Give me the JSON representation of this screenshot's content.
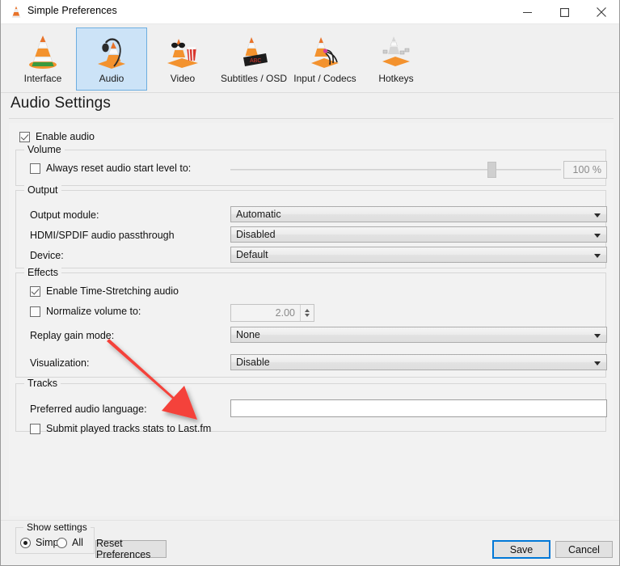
{
  "window": {
    "title": "Simple Preferences",
    "icon": "vlc-cone-icon",
    "minimize_label": "—",
    "maximize_label": "☐",
    "close_label": "✕"
  },
  "toolbar": {
    "tabs": [
      {
        "label": "Interface",
        "icon": "vlc-cone-icon",
        "selected": false
      },
      {
        "label": "Audio",
        "icon": "vlc-headphones-icon",
        "selected": true
      },
      {
        "label": "Video",
        "icon": "vlc-video-icon",
        "selected": false
      },
      {
        "label": "Subtitles / OSD",
        "icon": "vlc-subtitles-icon",
        "selected": false
      },
      {
        "label": "Input / Codecs",
        "icon": "vlc-input-codecs-icon",
        "selected": false
      },
      {
        "label": "Hotkeys",
        "icon": "vlc-hotkeys-icon",
        "selected": false
      }
    ]
  },
  "page": {
    "title": "Audio Settings"
  },
  "audio": {
    "enable_audio": {
      "label": "Enable audio",
      "checked": true
    },
    "volume": {
      "group_title": "Volume",
      "always_reset": {
        "label": "Always reset audio start level to:",
        "checked": false
      },
      "slider_value": 80,
      "spin_value": "100 %"
    },
    "output": {
      "group_title": "Output",
      "rows": [
        {
          "label": "Output module:",
          "value": "Automatic"
        },
        {
          "label": "HDMI/SPDIF audio passthrough",
          "value": "Disabled"
        },
        {
          "label": "Device:",
          "value": "Default"
        }
      ]
    },
    "effects": {
      "group_title": "Effects",
      "time_stretch": {
        "label": "Enable Time-Stretching audio",
        "checked": true
      },
      "normalize": {
        "label": "Normalize volume to:",
        "checked": false,
        "value": "2.00"
      },
      "replay_gain": {
        "label": "Replay gain mode:",
        "value": "None"
      },
      "visualization": {
        "label": "Visualization:",
        "value": "Disable"
      }
    },
    "tracks": {
      "group_title": "Tracks",
      "preferred_language": {
        "label": "Preferred audio language:",
        "value": "",
        "placeholder": ""
      },
      "lastfm": {
        "label": "Submit played tracks stats to Last.fm",
        "checked": false
      }
    }
  },
  "footer": {
    "show_settings_title": "Show settings",
    "simple_label": "Simple",
    "all_label": "All",
    "simple_selected": true,
    "reset_label": "Reset Preferences",
    "save_label": "Save",
    "cancel_label": "Cancel"
  },
  "annotation": {
    "arrow_color": "#f4433a",
    "description": "red-arrow-pointing-to-preferred-audio-language-field"
  },
  "colors": {
    "selected_tab_bg": "#cce3f7",
    "selected_tab_border": "#6daee0",
    "focus_border": "#0078d7",
    "window_bg": "#f0f0f0",
    "content_bg": "#f2f2f2"
  }
}
